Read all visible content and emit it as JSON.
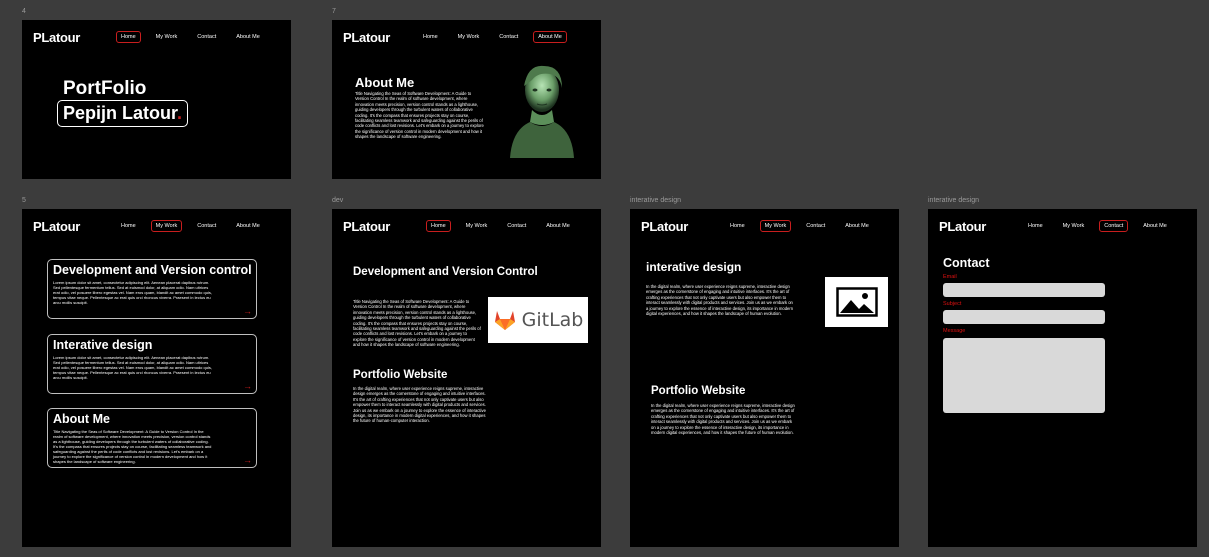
{
  "boards": {
    "b4": {
      "label": "4"
    },
    "b7": {
      "label": "7"
    },
    "b5": {
      "label": "5"
    },
    "bdev": {
      "label": "dev"
    },
    "bint": {
      "label": "interative design"
    },
    "bcon": {
      "label": "interative design"
    }
  },
  "logo": "PLatour",
  "nav": {
    "home": "Home",
    "work": "My Work",
    "contact": "Contact",
    "about": "About Me"
  },
  "home": {
    "title": "PortFolio",
    "name": "Pepijn Latour",
    "dot": "."
  },
  "about": {
    "title": "About Me",
    "text": "Title Navigating the Seas of Software Development: A Guide to Version Control In the realm of software development, where innovation meets precision, version control stands as a lighthouse, guiding developers through the turbulent waters of collaborative coding. It's the compass that ensures projects stay on course, facilitating seamless teamwork and safeguarding against the perils of code conflicts and lost revisions. Let's embark on a journey to explore the significance of version control in modern development and how it shapes the landscape of software engineering."
  },
  "work": {
    "cards": [
      {
        "title": "Development and Version control",
        "text": "Lorem ipsum dolor sit amet, consectetur adipiscing elit. Aenean placerat dapibus rutrum. Sed pellentesque fermentum tellus. Sed at euismod dolor, at aliquam odio. Nam ultrices erat odio, vel posuere libero egestas vel. Nam eros quam, blandit ac amet commodo quis, tempus vitae neque. Pellentesque ac erat quis orci rhoncus viverra. Praesent in lectus eu arcu mollis suscipit."
      },
      {
        "title": "Interative design",
        "text": "Lorem ipsum dolor sit amet, consectetur adipiscing elit. Aenean placerat dapibus rutrum. Sed pellentesque fermentum tellus. Sed at euismod dolor, at aliquam odio. Nam ultrices erat odio, vel posuere libero egestas vel. Nam eros quam, blandit ac amet commodo quis, tempus vitae neque. Pellentesque ac erat quis orci rhoncus viverra. Praesent in lectus eu arcu mollis suscipit."
      },
      {
        "title": "About Me",
        "text": "Title Navigating the Seas of Software Development: A Guide to Version Control In the realm of software development, where innovation meets precision, version control stands as a lighthouse, guiding developers through the turbulent waters of collaborative coding. It's the compass that ensures projects stay on course, facilitating seamless teamwork and safeguarding against the perils of code conflicts and lost revisions. Let's embark on a journey to explore the significance of version control in modern development and how it shapes the landscape of software engineering."
      }
    ],
    "arrow": "→"
  },
  "dev": {
    "title": "Development and Version Control",
    "text": "Title Navigating the Seas of Software Development: A Guide to Version Control In the realm of software development, where innovation meets precision, version control stands as a lighthouse, guiding developers through the turbulent waters of collaborative coding. It's the compass that ensures projects stay on course, facilitating seamless teamwork and safeguarding against the perils of code conflicts and lost revisions. Let's embark on a journey to explore the significance of version control in modern development and how it shapes the landscape of software engineering.",
    "gitlab": "GitLab",
    "portfolio_title": "Portfolio Website",
    "portfolio_text": "In the digital realm, where user experience reigns supreme, interactive design emerges as the cornerstone of engaging and intuitive interfaces. It's the art of crafting experiences that not only captivate users but also empower them to interact seamlessly with digital products and services. Join us as we embark on a journey to explore the essence of interactive design, its importance in modern digital experiences, and how it shapes the future of human-computer interaction."
  },
  "interactive": {
    "title": "interative design",
    "text": "In the digital realm, where user experience reigns supreme, interactive design emerges as the cornerstone of engaging and intuitive interfaces. It's the art of crafting experiences that not only captivate users but also empower them to interact seamlessly with digital products and services. Join us as we embark on a journey to explore the essence of interactive design, its importance in modern digital experiences, and how it shapes the landscape of human evolution.",
    "portfolio_title": "Portfolio Website",
    "portfolio_text": "In the digital realm, where user experience reigns supreme, interactive design emerges as the cornerstone of engaging and intuitive interfaces. It's the art of crafting experiences that not only captivate users but also empower them to interact seamlessly with digital products and services. Join us as we embark on a journey to explore the essence of interactive design, its importance in modern digital experiences, and how it shapes the future of human evolution."
  },
  "contact": {
    "title": "Contact",
    "email_label": "Email",
    "subject_label": "Subject",
    "message_label": "Message"
  },
  "colors": {
    "accent": "#c81e1e",
    "canvas": "#3c3c3c",
    "frame": "#000000",
    "field": "#d9d9d9"
  },
  "icons": [
    "image-placeholder-icon",
    "gitlab-logo-icon",
    "arrow-right-icon"
  ]
}
